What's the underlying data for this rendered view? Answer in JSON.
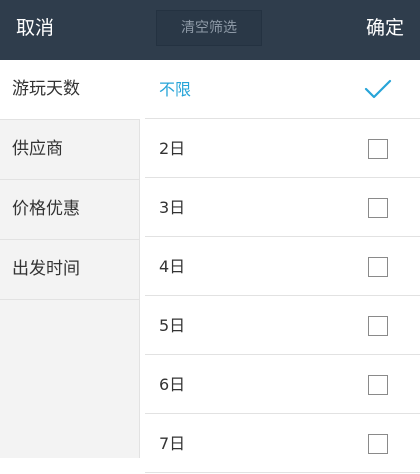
{
  "header": {
    "cancel_label": "取消",
    "clear_label": "清空筛选",
    "confirm_label": "确定"
  },
  "sidebar": {
    "items": [
      {
        "label": "游玩天数",
        "active": true
      },
      {
        "label": "供应商",
        "active": false
      },
      {
        "label": "价格优惠",
        "active": false
      },
      {
        "label": "出发时间",
        "active": false
      }
    ]
  },
  "options": {
    "items": [
      {
        "label": "不限",
        "checked": true
      },
      {
        "label": "2日",
        "checked": false
      },
      {
        "label": "3日",
        "checked": false
      },
      {
        "label": "4日",
        "checked": false
      },
      {
        "label": "5日",
        "checked": false
      },
      {
        "label": "6日",
        "checked": false
      },
      {
        "label": "7日",
        "checked": false
      }
    ]
  },
  "colors": {
    "header_bg": "#2f3d4c",
    "accent": "#27a4d8",
    "sidebar_bg": "#f3f3f3"
  },
  "icons": {
    "selected": "checkmark-icon",
    "unselected": "checkbox-icon"
  }
}
